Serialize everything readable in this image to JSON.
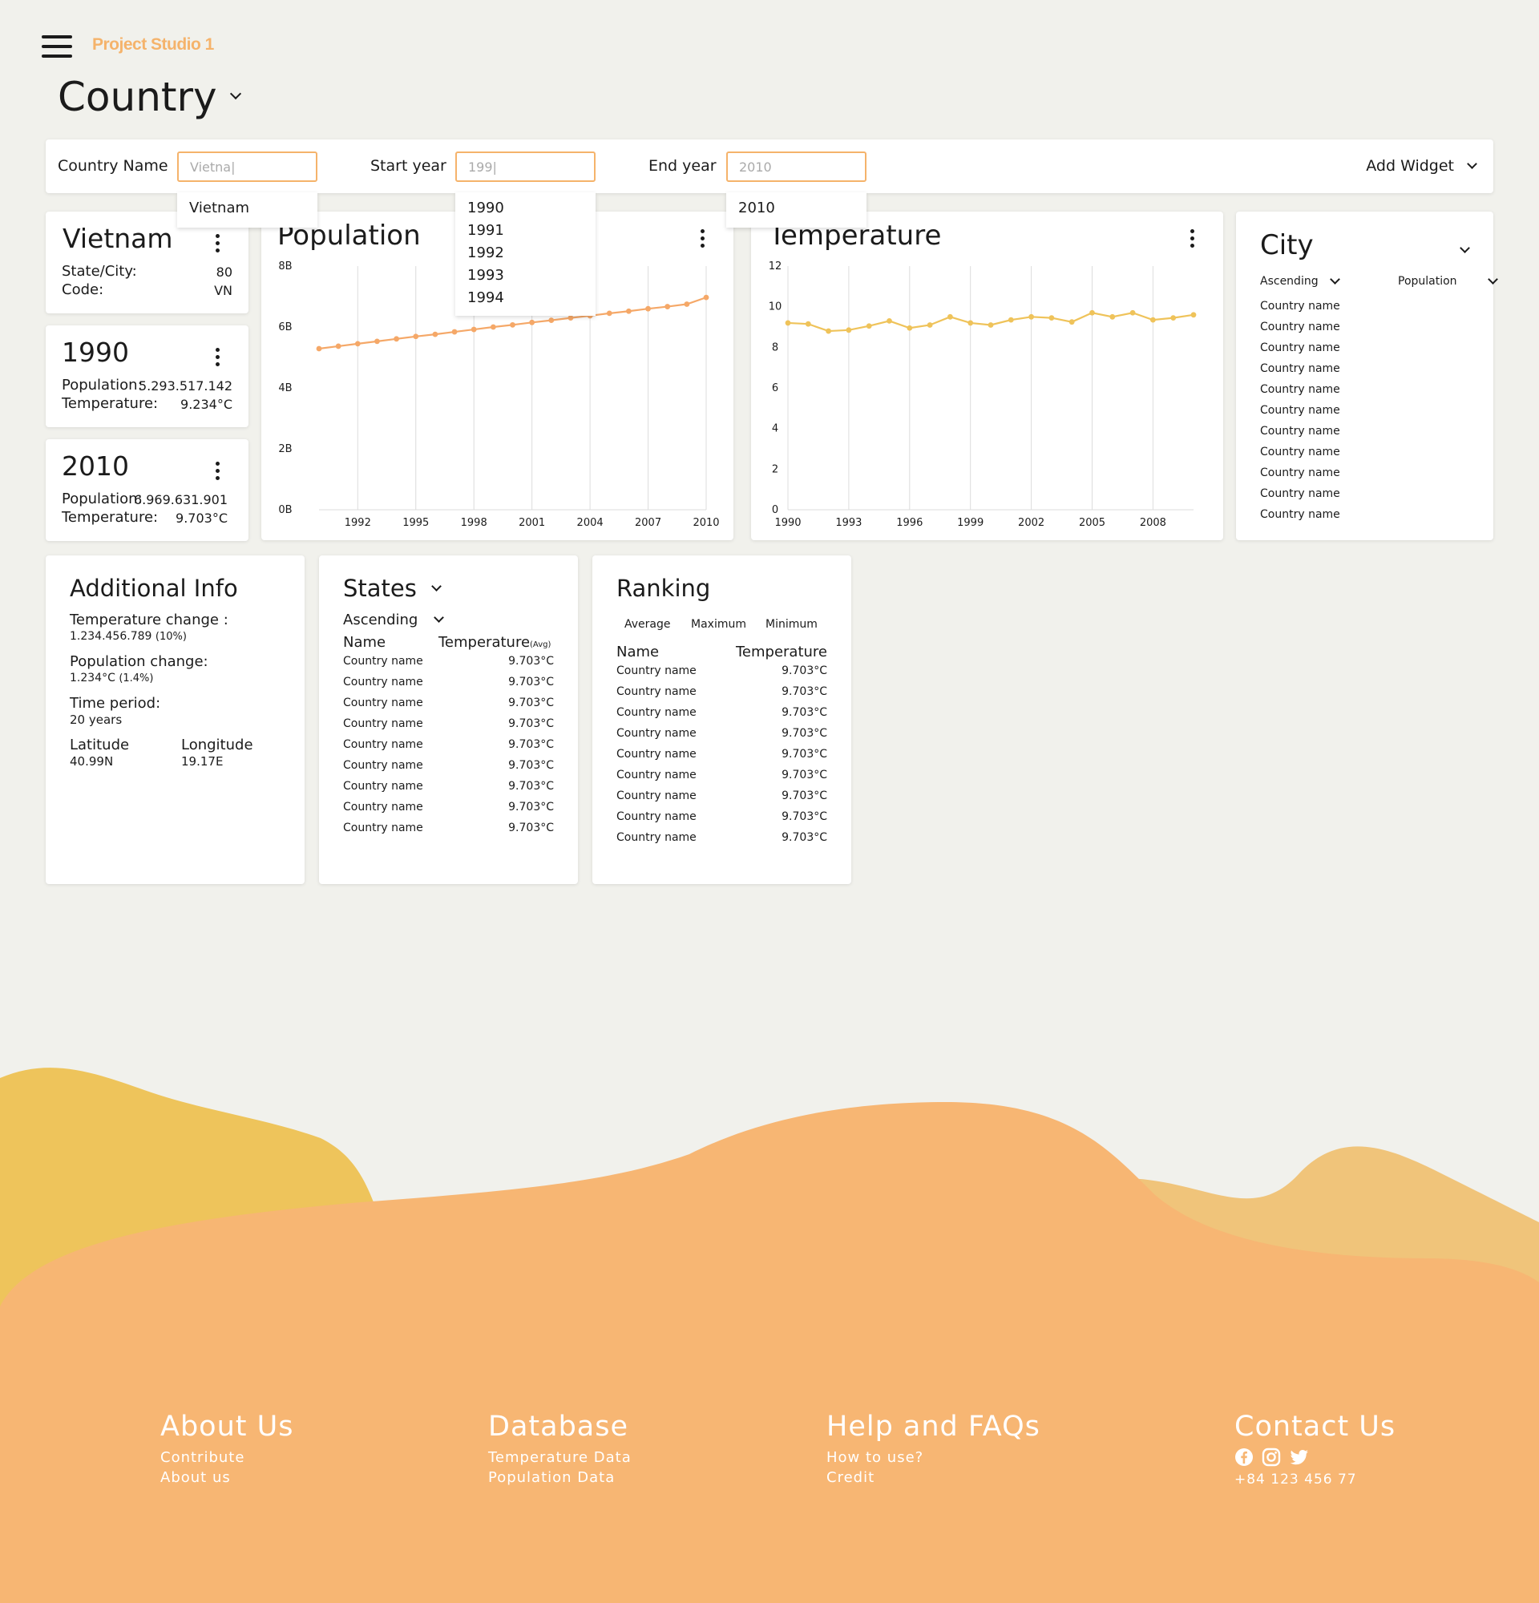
{
  "app": {
    "logo": "Project Studio 1",
    "page_title": "Country"
  },
  "filters": {
    "country_label": "Country Name",
    "country_value": "Vietna|",
    "country_suggestions": [
      "Vietnam"
    ],
    "start_label": "Start year",
    "start_value": "199|",
    "start_suggestions": [
      "1990",
      "1991",
      "1992",
      "1993",
      "1994"
    ],
    "end_label": "End year",
    "end_value": "2010",
    "end_suggestions": [
      "2010"
    ],
    "add_widget": "Add Widget"
  },
  "country_card": {
    "name": "Vietnam",
    "state_label": "State/City:",
    "state_value": "80",
    "code_label": "Code:",
    "code_value": "VN"
  },
  "year_cards": [
    {
      "year": "1990",
      "pop_label": "Population:",
      "pop_value": "5.293.517.142",
      "temp_label": "Temperature:",
      "temp_value": "9.234°C"
    },
    {
      "year": "2010",
      "pop_label": "Population:",
      "pop_value": "6.969.631.901",
      "temp_label": "Temperature:",
      "temp_value": "9.703°C"
    }
  ],
  "chart_data": [
    {
      "type": "line",
      "title": "Population",
      "x": [
        1990,
        1991,
        1992,
        1993,
        1994,
        1995,
        1996,
        1997,
        1998,
        1999,
        2000,
        2001,
        2002,
        2003,
        2004,
        2005,
        2006,
        2007,
        2008,
        2009,
        2010
      ],
      "values": [
        5.29,
        5.37,
        5.45,
        5.53,
        5.61,
        5.69,
        5.76,
        5.84,
        5.92,
        6.0,
        6.07,
        6.15,
        6.22,
        6.3,
        6.37,
        6.45,
        6.52,
        6.6,
        6.67,
        6.75,
        6.97
      ],
      "x_ticks": [
        1992,
        1995,
        1998,
        2001,
        2004,
        2007,
        2010
      ],
      "y_ticks": [
        "0B",
        "2B",
        "4B",
        "6B",
        "8B"
      ],
      "ylim": [
        0,
        8
      ],
      "color": "#f5a868",
      "grid": "vertical"
    },
    {
      "type": "line",
      "title": "Temperature",
      "x": [
        1990,
        1991,
        1992,
        1993,
        1994,
        1995,
        1996,
        1997,
        1998,
        1999,
        2000,
        2001,
        2002,
        2003,
        2004,
        2005,
        2006,
        2007,
        2008,
        2009,
        2010
      ],
      "values": [
        9.2,
        9.15,
        8.8,
        8.85,
        9.05,
        9.3,
        8.95,
        9.1,
        9.5,
        9.2,
        9.1,
        9.35,
        9.5,
        9.45,
        9.25,
        9.7,
        9.5,
        9.7,
        9.35,
        9.45,
        9.6
      ],
      "x_ticks": [
        1990,
        1993,
        1996,
        1999,
        2002,
        2005,
        2008
      ],
      "y_ticks": [
        "0",
        "2",
        "4",
        "6",
        "8",
        "10",
        "12"
      ],
      "ylim": [
        0,
        12
      ],
      "color": "#efc35a",
      "grid": "vertical"
    }
  ],
  "city": {
    "title": "City",
    "sort_order": "Ascending",
    "sort_field": "Population",
    "items": [
      "Country name",
      "Country name",
      "Country name",
      "Country name",
      "Country name",
      "Country name",
      "Country name",
      "Country name",
      "Country name",
      "Country name",
      "Country name"
    ]
  },
  "additional_info": {
    "title": "Additional Info",
    "temp_change_label": "Temperature change :",
    "temp_change_value": "1.234.456.789",
    "temp_change_pct": "(10%)",
    "pop_change_label": "Population change:",
    "pop_change_value": "1.234°C",
    "pop_change_pct": "(1.4%)",
    "period_label": "Time period:",
    "period_value": "20 years",
    "lat_label": "Latitude",
    "lat_value": "40.99N",
    "lon_label": "Longitude",
    "lon_value": "19.17E"
  },
  "states": {
    "title": "States",
    "sort_order": "Ascending",
    "col_name": "Name",
    "col_temp": "Temperature",
    "col_temp_sub": "(Avg)",
    "rows": [
      [
        "Country name",
        "9.703°C"
      ],
      [
        "Country name",
        "9.703°C"
      ],
      [
        "Country name",
        "9.703°C"
      ],
      [
        "Country name",
        "9.703°C"
      ],
      [
        "Country name",
        "9.703°C"
      ],
      [
        "Country name",
        "9.703°C"
      ],
      [
        "Country name",
        "9.703°C"
      ],
      [
        "Country name",
        "9.703°C"
      ],
      [
        "Country name",
        "9.703°C"
      ]
    ]
  },
  "ranking": {
    "title": "Ranking",
    "tabs": [
      "Average",
      "Maximum",
      "Minimum"
    ],
    "col_name": "Name",
    "col_temp": "Temperature",
    "rows": [
      [
        "Country name",
        "9.703°C"
      ],
      [
        "Country name",
        "9.703°C"
      ],
      [
        "Country name",
        "9.703°C"
      ],
      [
        "Country name",
        "9.703°C"
      ],
      [
        "Country name",
        "9.703°C"
      ],
      [
        "Country name",
        "9.703°C"
      ],
      [
        "Country name",
        "9.703°C"
      ],
      [
        "Country name",
        "9.703°C"
      ],
      [
        "Country name",
        "9.703°C"
      ]
    ]
  },
  "footer": {
    "about": {
      "title": "About Us",
      "links": [
        "Contribute",
        "About us"
      ]
    },
    "database": {
      "title": "Database",
      "links": [
        "Temperature Data",
        "Population Data"
      ]
    },
    "help": {
      "title": "Help and FAQs",
      "links": [
        "How to use?",
        "Credit"
      ]
    },
    "contact": {
      "title": "Contact Us",
      "phone": "+84 123 456 77",
      "icons": [
        "facebook-icon",
        "instagram-icon",
        "twitter-icon"
      ]
    }
  },
  "colors": {
    "accent": "#f5b36b",
    "wave_yellow": "#eec45b",
    "wave_orange": "#f7b673",
    "wave_light": "#f0c47a",
    "background": "#f1f1ec"
  }
}
